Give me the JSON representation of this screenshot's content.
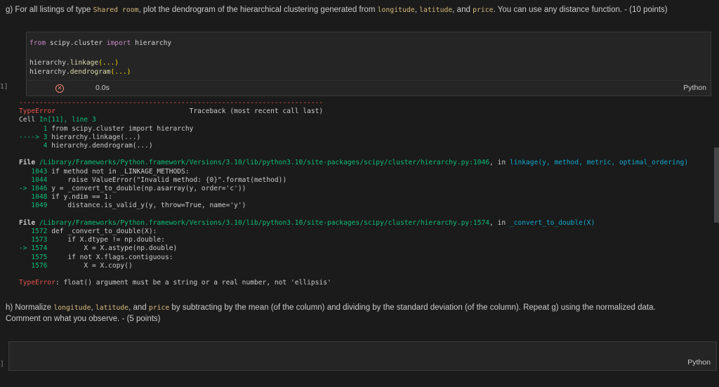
{
  "colors": {
    "red": "#e5534b",
    "green": "#0dbc79",
    "cyan": "#11a8cd",
    "fg": "#cccccc",
    "codeFg": "#d4d4d4",
    "purple": "#c586c0",
    "fnYellow": "#dcdcaa",
    "gold": "#ffd700",
    "salmon": "#f48771",
    "gutter": "#8a8a8a"
  },
  "markdown_g": {
    "segments": [
      {
        "t": "g) For all listings of type "
      },
      {
        "t": "Shared room",
        "code": true
      },
      {
        "t": ", plot the dendrogram of the hierarchical clustering generated from "
      },
      {
        "t": "longitude",
        "code": true
      },
      {
        "t": ", "
      },
      {
        "t": "latitude",
        "code": true
      },
      {
        "t": ", and "
      },
      {
        "t": "price",
        "code": true
      },
      {
        "t": ". You can use any distance function. - (10 points)"
      }
    ]
  },
  "markdown_h": {
    "line1_segments": [
      {
        "t": "h) Normalize "
      },
      {
        "t": "longitude",
        "code": true
      },
      {
        "t": ", "
      },
      {
        "t": "latitude",
        "code": true
      },
      {
        "t": ", and "
      },
      {
        "t": "price",
        "code": true
      },
      {
        "t": " by subtracting by the mean (of the column) and dividing by the standard deviation (of the column). Repeat g) using the normalized data."
      }
    ],
    "line2": "Comment on what you observe. - (5 points)"
  },
  "cell1": {
    "gutter_label": "1]",
    "code_lines": [
      [
        {
          "t": "from",
          "c": "purple"
        },
        {
          "t": " scipy.cluster ",
          "c": "codeFg"
        },
        {
          "t": "import",
          "c": "purple"
        },
        {
          "t": " hierarchy",
          "c": "codeFg"
        }
      ],
      [],
      [
        {
          "t": "hierarchy.",
          "c": "codeFg"
        },
        {
          "t": "linkage",
          "c": "fnYellow"
        },
        {
          "t": "(...)",
          "c": "gold"
        }
      ],
      [
        {
          "t": "hierarchy.",
          "c": "codeFg"
        },
        {
          "t": "dendrogram",
          "c": "fnYellow"
        },
        {
          "t": "(...)",
          "c": "gold"
        }
      ]
    ],
    "status": {
      "error_icon": "error-circle-x-icon",
      "duration": "0.0s",
      "language": "Python"
    }
  },
  "traceback": {
    "lines": [
      [
        {
          "t": "---------------------------------------------------------------------------",
          "c": "red"
        }
      ],
      [
        {
          "t": "TypeError",
          "c": "red"
        },
        {
          "t": "                                 Traceback (most recent call last)",
          "c": "fg"
        }
      ],
      [
        {
          "t": "Cell ",
          "c": "fg"
        },
        {
          "t": "In[11], line 3",
          "c": "green"
        }
      ],
      [
        {
          "t": "      1",
          "c": "green"
        },
        {
          "t": " from scipy.cluster import hierarchy",
          "c": "fg"
        }
      ],
      [
        {
          "t": "----> 3",
          "c": "green"
        },
        {
          "t": " hierarchy.linkage(...)",
          "c": "fg"
        }
      ],
      [
        {
          "t": "      4",
          "c": "green"
        },
        {
          "t": " hierarchy.dendrogram(...)",
          "c": "fg"
        }
      ],
      [],
      [
        {
          "t": "File ",
          "c": "fg",
          "b": true
        },
        {
          "t": "/Library/Frameworks/Python.framework/Versions/3.10/lib/python3.10/site-packages/scipy/cluster/hierarchy.py:1046",
          "c": "green"
        },
        {
          "t": ", in ",
          "c": "fg"
        },
        {
          "t": "linkage(y, method, metric, optimal_ordering)",
          "c": "cyan"
        }
      ],
      [
        {
          "t": "   1043",
          "c": "green"
        },
        {
          "t": " if method not in _LINKAGE_METHODS:",
          "c": "fg"
        }
      ],
      [
        {
          "t": "   1044",
          "c": "green"
        },
        {
          "t": "     raise ValueError(\"Invalid method: {0}\".format(method))",
          "c": "fg"
        }
      ],
      [
        {
          "t": "-> 1046",
          "c": "green"
        },
        {
          "t": " y = _convert_to_double(np.asarray(y, order='c'))",
          "c": "fg"
        }
      ],
      [
        {
          "t": "   1048",
          "c": "green"
        },
        {
          "t": " if y.ndim == 1:",
          "c": "fg"
        }
      ],
      [
        {
          "t": "   1049",
          "c": "green"
        },
        {
          "t": "     distance.is_valid_y(y, throw=True, name='y')",
          "c": "fg"
        }
      ],
      [],
      [
        {
          "t": "File ",
          "c": "fg",
          "b": true
        },
        {
          "t": "/Library/Frameworks/Python.framework/Versions/3.10/lib/python3.10/site-packages/scipy/cluster/hierarchy.py:1574",
          "c": "green"
        },
        {
          "t": ", in ",
          "c": "fg"
        },
        {
          "t": "_convert_to_double(X)",
          "c": "cyan"
        }
      ],
      [
        {
          "t": "   1572",
          "c": "green"
        },
        {
          "t": " def _convert_to_double(X):",
          "c": "fg"
        }
      ],
      [
        {
          "t": "   1573",
          "c": "green"
        },
        {
          "t": "     if X.dtype != np.double:",
          "c": "fg"
        }
      ],
      [
        {
          "t": "-> 1574",
          "c": "green"
        },
        {
          "t": "         X = X.astype(np.double)",
          "c": "fg"
        }
      ],
      [
        {
          "t": "   1575",
          "c": "green"
        },
        {
          "t": "     if not X.flags.contiguous:",
          "c": "fg"
        }
      ],
      [
        {
          "t": "   1576",
          "c": "green"
        },
        {
          "t": "         X = X.copy()",
          "c": "fg"
        }
      ],
      [],
      [
        {
          "t": "TypeError",
          "c": "red"
        },
        {
          "t": ": float() argument must be a string or a real number, not 'ellipsis'",
          "c": "fg"
        }
      ]
    ]
  },
  "cell2": {
    "gutter_label": "]",
    "language": "Python"
  }
}
